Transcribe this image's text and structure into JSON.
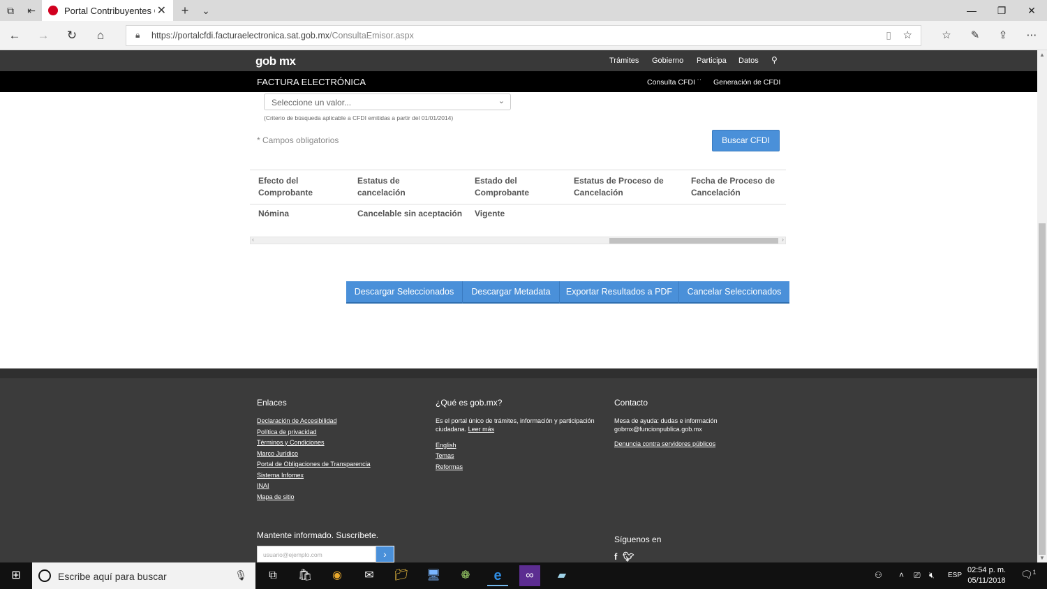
{
  "browser": {
    "tab_title": "Portal Contribuyentes C",
    "url_host": "https://portalcfdi.facturaelectronica.sat.gob.mx",
    "url_path": "/ConsultaEmisor.aspx"
  },
  "site_header": {
    "logo": "gob mx",
    "nav": [
      "Trámites",
      "Gobierno",
      "Participa",
      "Datos"
    ],
    "section_title": "FACTURA ELECTRÓNICA",
    "section_nav": [
      "Consulta CFDI ˙˙",
      "Generación de CFDI"
    ]
  },
  "form": {
    "select_value": "Seleccione un valor...",
    "criterio_note": "(Criterio de búsqueda aplicable a CFDI emitidas a partir del 01/01/2014)",
    "required_note": "* Campos obligatorios",
    "search_button": "Buscar CFDI"
  },
  "results_table": {
    "headers": [
      [
        "Efecto del",
        "Comprobante"
      ],
      [
        "Estatus de",
        "cancelación"
      ],
      [
        "Estado del",
        "Comprobante"
      ],
      [
        "Estatus de Proceso de",
        "Cancelación"
      ],
      [
        "Fecha de Proceso de",
        "Cancelación"
      ]
    ],
    "row": [
      "Nómina",
      "Cancelable sin aceptación",
      "Vigente",
      "",
      ""
    ]
  },
  "actions": [
    "Descargar Seleccionados",
    "Descargar Metadata",
    "Exportar Resultados a PDF",
    "Cancelar Seleccionados"
  ],
  "footer": {
    "enlaces_title": "Enlaces",
    "enlaces": [
      "Declaración de Accesibilidad",
      "Política de privacidad",
      "Términos y Condiciones",
      "Marco Jurídico",
      "Portal de Obligaciones de Transparencia",
      "Sistema Infomex",
      "INAI",
      "Mapa de sitio"
    ],
    "que_es_title": "¿Qué es gob.mx?",
    "que_es_text": "Es el portal único de trámites, información y participación ciudadana.",
    "leer_mas": "Leer más",
    "que_es_links": [
      "English",
      "Temas",
      "Reformas"
    ],
    "contacto_title": "Contacto",
    "contacto_text_1": "Mesa de ayuda: dudas e información",
    "contacto_text_2": "gobmx@funcionpublica.gob.mx",
    "denuncia": "Denuncia contra servidores públicos",
    "subscribe_title": "Mantente informado. Suscríbete.",
    "subscribe_placeholder": "usuario@ejemplo.com",
    "siguenos": "Síguenos en"
  },
  "taskbar": {
    "search_text": "Escribe aquí para buscar",
    "lang": "ESP",
    "time": "02:54 p. m.",
    "date": "05/11/2018",
    "notif_count": "1"
  }
}
